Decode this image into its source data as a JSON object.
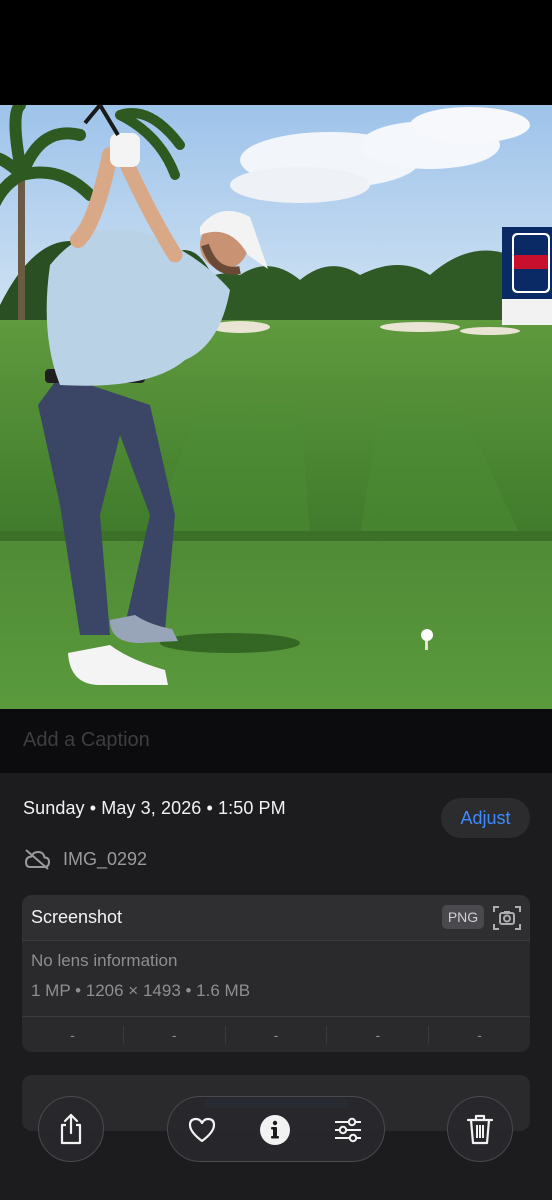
{
  "photo": {
    "subject": "golfer-backswing-on-tee",
    "badge_text": "PGA TOUR",
    "badge_colors": {
      "blue": "#0a2a66",
      "red": "#c8102e"
    }
  },
  "caption": {
    "placeholder": "Add a Caption"
  },
  "details": {
    "date_line": "Sunday • May 3, 2026 • 1:50 PM",
    "adjust_label": "Adjust",
    "file_name": "IMG_0292",
    "file_icon": "cloud-off-icon"
  },
  "info_card": {
    "title": "Screenshot",
    "format_badge": "PNG",
    "lens": "No lens information",
    "specs": "1 MP • 1206 × 1493 • 1.6 MB",
    "exif": [
      "-",
      "-",
      "-",
      "-",
      "-"
    ]
  },
  "toolbar": {
    "share_icon": "share-icon",
    "favorite_icon": "heart-icon",
    "info_icon": "info-icon",
    "adjust_icon": "sliders-icon",
    "delete_icon": "trash-icon"
  },
  "colors": {
    "accent": "#3d8bff",
    "sheet_bg": "#1c1c1e",
    "card_bg": "#2a2a2c"
  }
}
